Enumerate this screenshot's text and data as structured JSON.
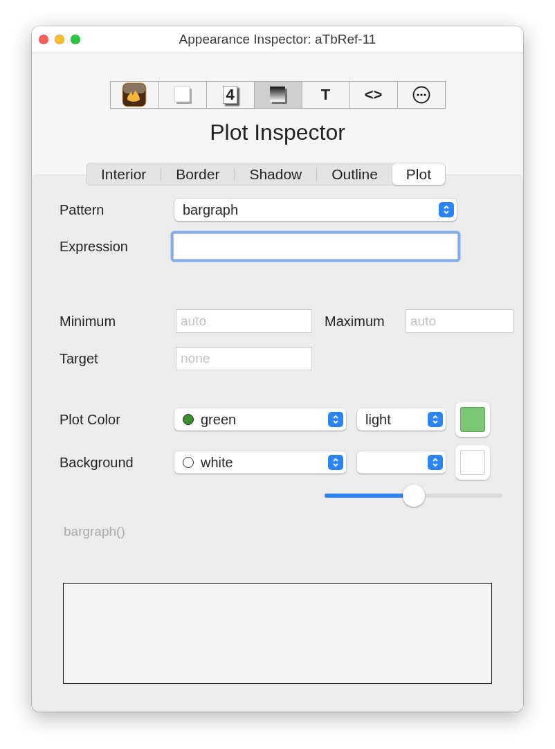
{
  "window": {
    "title": "Appearance Inspector: aTbRef-11"
  },
  "toolbar": [
    {
      "kind": "app",
      "selected": false
    },
    {
      "kind": "square",
      "selected": false
    },
    {
      "kind": "digit",
      "label": "4",
      "selected": false
    },
    {
      "kind": "shade",
      "selected": true
    },
    {
      "kind": "glyph",
      "label": "T",
      "selected": false
    },
    {
      "kind": "glyph",
      "label": "<>",
      "selected": false
    },
    {
      "kind": "more",
      "selected": false
    }
  ],
  "heading": "Plot Inspector",
  "tabs": [
    {
      "label": "Interior",
      "selected": false
    },
    {
      "label": "Border",
      "selected": false
    },
    {
      "label": "Shadow",
      "selected": false
    },
    {
      "label": "Outline",
      "selected": false
    },
    {
      "label": "Plot",
      "selected": true
    }
  ],
  "pattern": {
    "label": "Pattern",
    "value": "bargraph"
  },
  "expression": {
    "label": "Expression",
    "focused": true
  },
  "minimum": {
    "label": "Minimum",
    "placeholder": "auto"
  },
  "maximum": {
    "label": "Maximum",
    "placeholder": "auto"
  },
  "target": {
    "label": "Target",
    "placeholder": "none"
  },
  "plot_color": {
    "label": "Plot Color",
    "value": "green",
    "dot": {
      "color": "#3a8f2c"
    },
    "shade": "light",
    "well": {
      "color": "#7bc774"
    }
  },
  "background": {
    "label": "Background",
    "value": "white",
    "dot": {
      "color": "#ffffff"
    },
    "well": {
      "color": "#ffffff"
    },
    "slider": {
      "level": 0.5
    }
  },
  "formula": "bargraph()"
}
